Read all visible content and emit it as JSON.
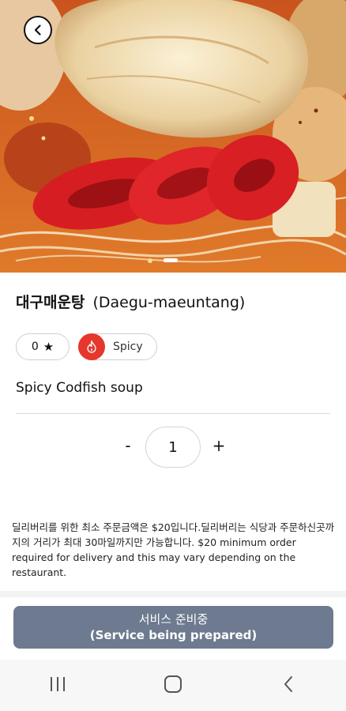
{
  "dish": {
    "name_ko": "대구매운탕",
    "name_en": "(Daegu-maeuntang)",
    "description": "Spicy Codfish soup"
  },
  "rating": {
    "value": "0",
    "star": "★"
  },
  "tags": [
    {
      "label": "Spicy",
      "icon": "flame-icon",
      "color": "#e5372b"
    }
  ],
  "quantity": {
    "minus": "-",
    "value": "1",
    "plus": "+"
  },
  "notice": "딜리버리를 위한 최소 주문금액은 $20입니다.딜리버리는 식당과 주문하신곳까지의 거리가 최대 30마일까지만 가능합니다. $20 minimum order required for delivery and this may vary depending on the restaurant.",
  "cta": {
    "label_ko": "서비스 준비중",
    "label_en": "(Service being prepared)",
    "color": "#6d7a8f"
  },
  "navbar": {
    "icons": [
      "recent-apps-icon",
      "home-icon",
      "back-icon"
    ]
  }
}
